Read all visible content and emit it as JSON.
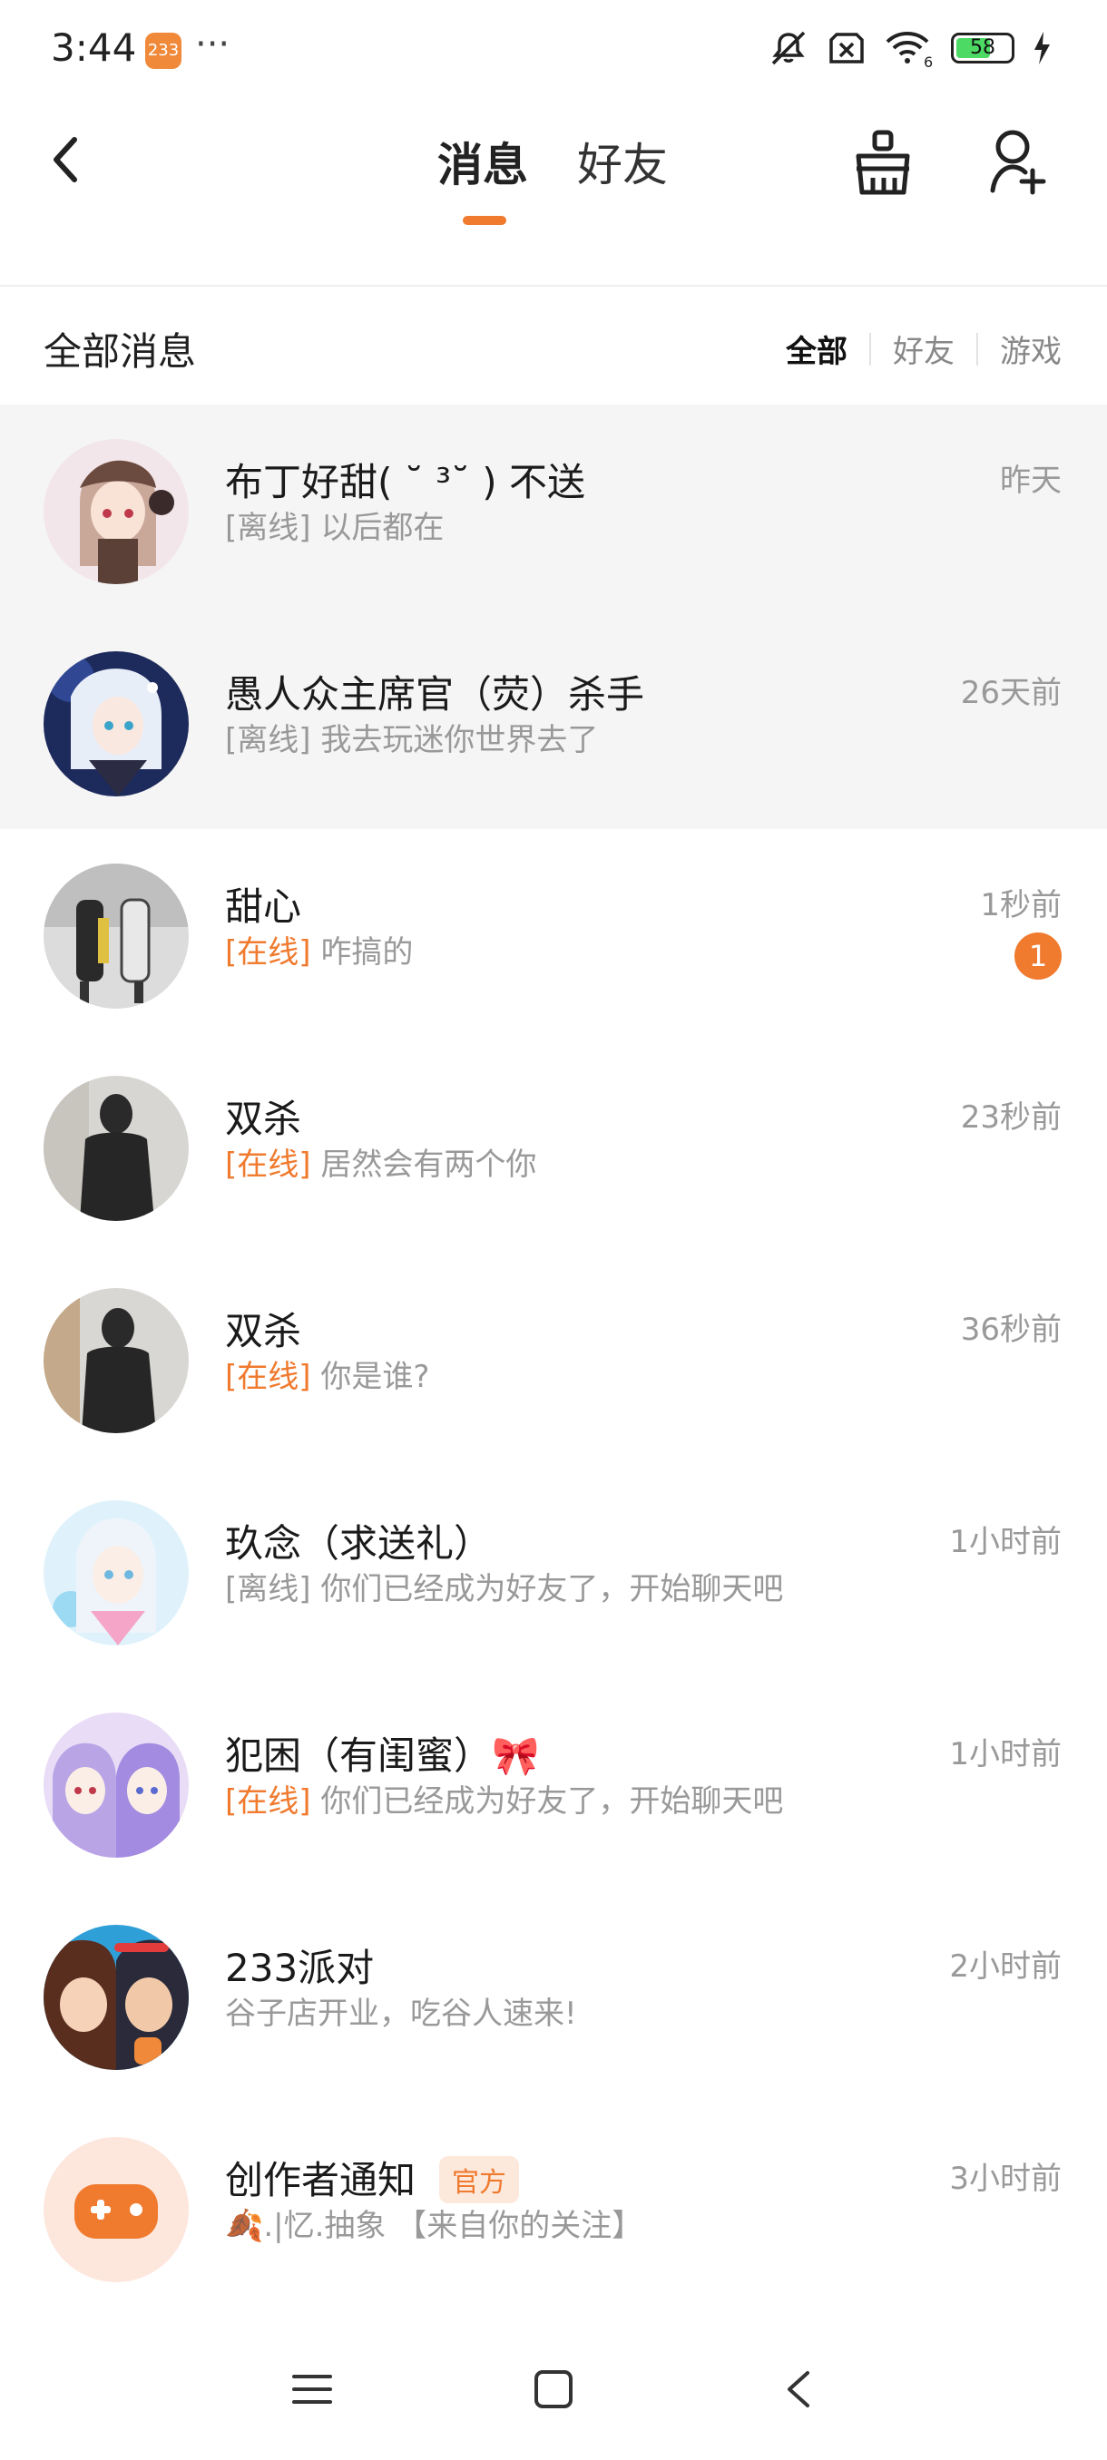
{
  "status_bar": {
    "time": "3:44",
    "app_notification": "233",
    "more": "···",
    "battery_level": "58",
    "icons": [
      "mute-icon",
      "sim-off-icon",
      "wifi-6-icon",
      "battery-icon",
      "charging-icon"
    ]
  },
  "header": {
    "tabs": [
      {
        "label": "消息",
        "active": true
      },
      {
        "label": "好友",
        "active": false
      }
    ],
    "icons": [
      "back-icon",
      "clean-icon",
      "add-friend-icon"
    ],
    "accent_color": "#f07a2e"
  },
  "filter": {
    "title": "全部消息",
    "options": [
      {
        "label": "全部",
        "active": true
      },
      {
        "label": "好友",
        "active": false
      },
      {
        "label": "游戏",
        "active": false
      }
    ]
  },
  "conversations": [
    {
      "name": "布丁好甜( ˘ ³˘ ) 不送",
      "status": "[离线]",
      "online": false,
      "message": "以后都在",
      "time": "昨天",
      "pinned": true
    },
    {
      "name": "愚人众主席官（荧）杀手",
      "status": "[离线]",
      "online": false,
      "message": "我去玩迷你世界去了",
      "time": "26天前",
      "pinned": true
    },
    {
      "name": "甜心",
      "status": "[在线]",
      "online": true,
      "message": "咋搞的",
      "time": "1秒前",
      "badge": "1"
    },
    {
      "name": "双杀",
      "status": "[在线]",
      "online": true,
      "message": "居然会有两个你",
      "time": "23秒前"
    },
    {
      "name": "双杀",
      "status": "[在线]",
      "online": true,
      "message": "你是谁?",
      "time": "36秒前"
    },
    {
      "name": "玖念（求送礼）",
      "status": "[离线]",
      "online": false,
      "message": "你们已经成为好友了，开始聊天吧",
      "time": "1小时前"
    },
    {
      "name": "犯困（有闺蜜）🎀",
      "status": "[在线]",
      "online": true,
      "message": "你们已经成为好友了，开始聊天吧",
      "time": "1小时前"
    },
    {
      "name": "233派对",
      "message": "谷子店开业，吃谷人速来!",
      "time": "2小时前"
    },
    {
      "name": "创作者通知",
      "official_label": "官方",
      "message": "🍂.|忆.抽象 【来自你的关注】",
      "time": "3小时前"
    }
  ],
  "nav_bar": {
    "icons": [
      "menu-icon",
      "home-icon",
      "back-icon"
    ]
  }
}
